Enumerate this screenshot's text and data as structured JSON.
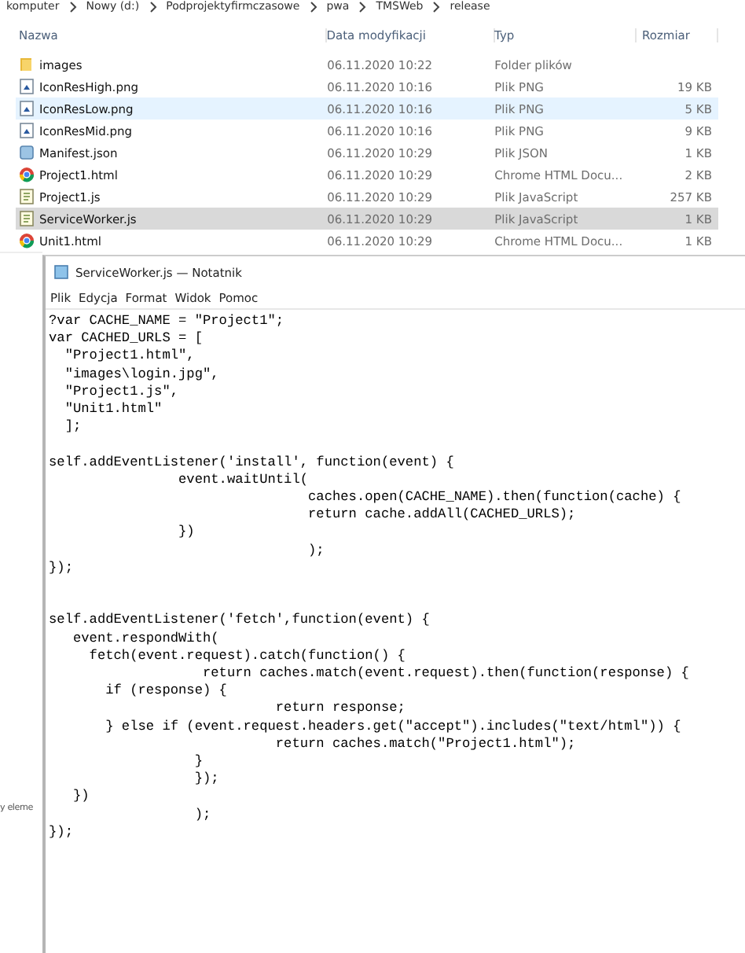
{
  "explorer": {
    "breadcrumb": [
      "komputer",
      "Nowy (d:)",
      "Podprojektyfirmczasowe",
      "pwa",
      "TMSWeb",
      "release"
    ],
    "columns": [
      "Nazwa",
      "Data modyfikacji",
      "Typ",
      "Rozmiar"
    ],
    "rows": [
      {
        "kind": "folder",
        "name": "images",
        "date": "06.11.2020 10:22",
        "type": "Folder plików",
        "selected": false,
        "hovered": false
      },
      {
        "kind": "image",
        "name": "IconResHigh.png",
        "date": "06.11.2020 10:16",
        "type": "Plik PNG",
        "size": "19 KB",
        "selected": false,
        "hovered": false
      },
      {
        "kind": "image",
        "name": "IconResLow.png",
        "date": "06.11.2020 10:16",
        "type": "Plik PNG",
        "size": "5 KB",
        "selected": false,
        "hovered": true
      },
      {
        "kind": "image",
        "name": "IconResMid.png",
        "date": "06.11.2020 10:16",
        "type": "Plik PNG",
        "size": "9 KB",
        "selected": false,
        "hovered": false
      },
      {
        "kind": "json",
        "name": "Manifest.json",
        "date": "06.11.2020 10:29",
        "type": "Plik JSON",
        "size": "1 KB",
        "selected": false,
        "hovered": false
      },
      {
        "kind": "chrome",
        "name": "Project1.html",
        "date": "06.11.2020 10:29",
        "type": "Chrome HTML Docu...",
        "size": "2 KB",
        "selected": false,
        "hovered": false
      },
      {
        "kind": "script",
        "name": "Project1.js",
        "date": "06.11.2020 10:29",
        "type": "Plik JavaScript",
        "size": "257 KB",
        "selected": false,
        "hovered": false
      },
      {
        "kind": "script",
        "name": "ServiceWorker.js",
        "date": "06.11.2020 10:29",
        "type": "Plik JavaScript",
        "size": "1 KB",
        "selected": true,
        "hovered": false
      },
      {
        "kind": "chrome",
        "name": "Unit1.html",
        "date": "06.11.2020 10:29",
        "type": "Chrome HTML Docu...",
        "size": "1 KB",
        "selected": false,
        "hovered": false
      }
    ],
    "status_text": "y eleme"
  },
  "notepad": {
    "title": "ServiceWorker.js — Notatnik",
    "menu": [
      "Plik",
      "Edycja",
      "Format",
      "Widok",
      "Pomoc"
    ],
    "code": "?var CACHE_NAME = \"Project1\";\nvar CACHED_URLS = [\n  \"Project1.html\",\n  \"images\\login.jpg\",\n  \"Project1.js\",\n  \"Unit1.html\"\n  ];\n\nself.addEventListener('install', function(event) {\n                event.waitUntil(\n                                caches.open(CACHE_NAME).then(function(cache) {\n                                return cache.addAll(CACHED_URLS);\n                })\n                                );\n});\n\n\nself.addEventListener('fetch',function(event) {\n   event.respondWith(\n     fetch(event.request).catch(function() {\n                   return caches.match(event.request).then(function(response) {\n       if (response) {\n                            return response;\n       } else if (event.request.headers.get(\"accept\").includes(\"text/html\")) {\n                            return caches.match(\"Project1.html\");\n                  }\n                  });\n   })\n                  );\n});"
  }
}
